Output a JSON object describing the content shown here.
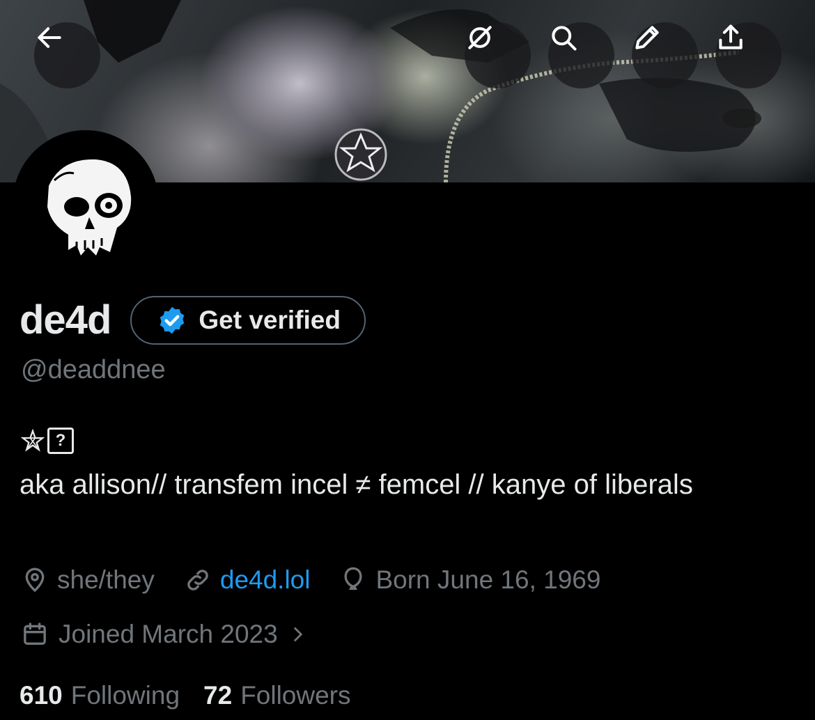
{
  "header": {
    "back_icon": "arrow-left-icon",
    "actions": [
      "grok-icon",
      "search-icon",
      "edit-pencil-icon",
      "share-upload-icon"
    ]
  },
  "profile": {
    "display_name": "de4d",
    "verify_label": "Get verified",
    "handle": "@deaddnee",
    "bio_emoji_box": "?",
    "bio": "aka allison// transfem incel ≠ femcel // kanye of liberals",
    "pronouns": "she/they",
    "website": "de4d.lol",
    "birthday": "Born June 16, 1969",
    "joined": "Joined March 2023"
  },
  "stats": {
    "following_count": "610",
    "following_label": "Following",
    "followers_count": "72",
    "followers_label": "Followers"
  },
  "colors": {
    "link": "#1d9bf0",
    "muted": "#71767b",
    "text": "#e7e9ea",
    "verified_badge": "#1d9bf0"
  }
}
